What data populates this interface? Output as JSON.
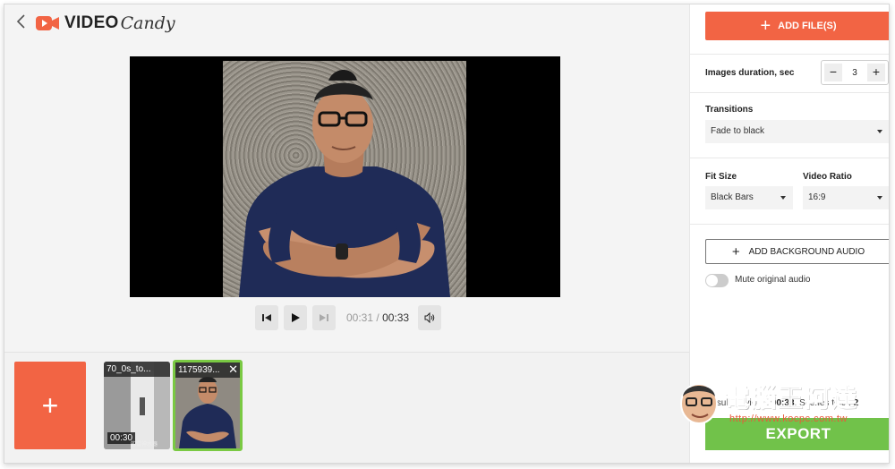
{
  "header": {
    "logo_video": "VIDEO",
    "logo_candy": "Candy",
    "back_icon": "chevron-left-icon"
  },
  "player": {
    "current_time": "00:31",
    "separator": "/",
    "duration": "00:33"
  },
  "timeline": {
    "add_label": "+",
    "clips": [
      {
        "title": "70_0s_to...",
        "duration": "00:30",
        "subtitle": "的雷神水器"
      },
      {
        "title": "1175939...",
        "close": "✕"
      }
    ]
  },
  "panel": {
    "add_files_label": "ADD FILE(S)",
    "images_duration_label": "Images duration, sec",
    "images_duration_value": "3",
    "minus": "−",
    "plus": "+",
    "transitions_label": "Transitions",
    "transitions_value": "Fade to black",
    "fit_size_label": "Fit Size",
    "fit_size_value": "Black Bars",
    "video_ratio_label": "Video Ratio",
    "video_ratio_value": "16:9",
    "background_audio_label": "ADD BACKGROUND AUDIO",
    "mute_label": "Mute original audio",
    "resulting_prefix": "Resulting video:",
    "resulting_duration": "00:33",
    "resulting_scenes_prefix": ", Scenes total:",
    "resulting_scenes": "2",
    "export_label": "EXPORT"
  },
  "watermark": {
    "title": "電腦王阿達",
    "url": "http://www.kocpc.com.tw"
  },
  "colors": {
    "accent": "#f26444",
    "export": "#71c24a",
    "selected_clip_border": "#7ac943"
  }
}
